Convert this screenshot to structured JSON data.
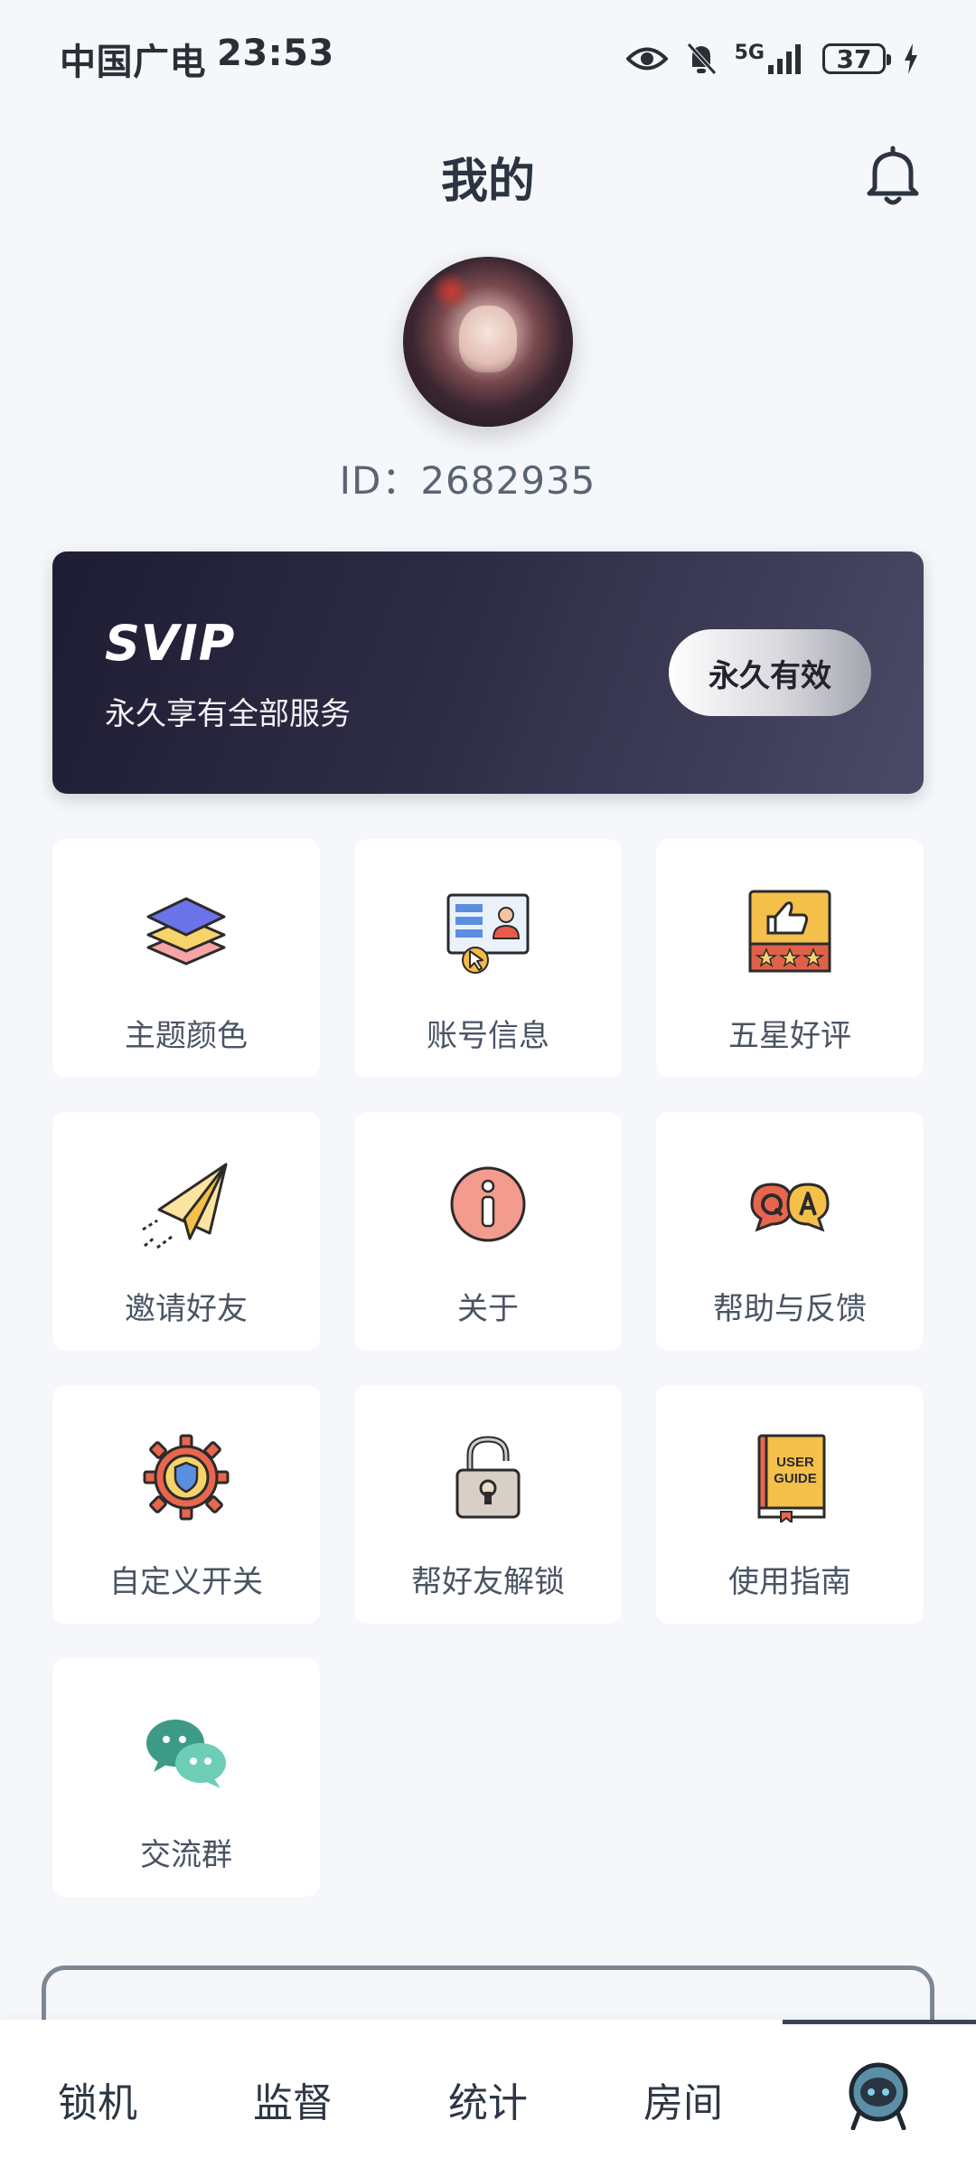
{
  "status_bar": {
    "carrier": "中国广电",
    "time": "23:53",
    "network": "5G",
    "battery": "37",
    "icons": [
      "eye-icon",
      "bell-off-icon",
      "signal-icon",
      "battery-icon",
      "charging-icon"
    ]
  },
  "header": {
    "title": "我的",
    "notification_icon": "bell-icon"
  },
  "profile": {
    "avatar": "avatar",
    "id_text": "ID：2682935"
  },
  "svip": {
    "title": "SVIP",
    "subtitle": "永久享有全部服务",
    "button": "永久有效"
  },
  "grid": {
    "items": [
      {
        "label": "主题颜色",
        "icon": "layers-icon"
      },
      {
        "label": "账号信息",
        "icon": "account-card-icon"
      },
      {
        "label": "五星好评",
        "icon": "thumbs-up-stars-icon"
      },
      {
        "label": "邀请好友",
        "icon": "paper-plane-icon"
      },
      {
        "label": "关于",
        "icon": "info-icon"
      },
      {
        "label": "帮助与反馈",
        "icon": "qa-bubbles-icon"
      },
      {
        "label": "自定义开关",
        "icon": "gear-shield-icon"
      },
      {
        "label": "帮好友解锁",
        "icon": "padlock-icon"
      },
      {
        "label": "使用指南",
        "icon": "user-guide-book-icon"
      },
      {
        "label": "交流群",
        "icon": "wechat-icon"
      }
    ],
    "guide_book_text": [
      "USER",
      "GUIDE"
    ]
  },
  "bottom_nav": {
    "items": [
      "锁机",
      "监督",
      "统计",
      "房间"
    ],
    "active_icon": "robot-avatar-icon"
  },
  "colors": {
    "background": "#f5f7fa",
    "svip_gradient_start": "#1f1d33",
    "svip_gradient_end": "#4a4a66",
    "text_primary": "#2b3440",
    "text_secondary": "#4a5463"
  }
}
